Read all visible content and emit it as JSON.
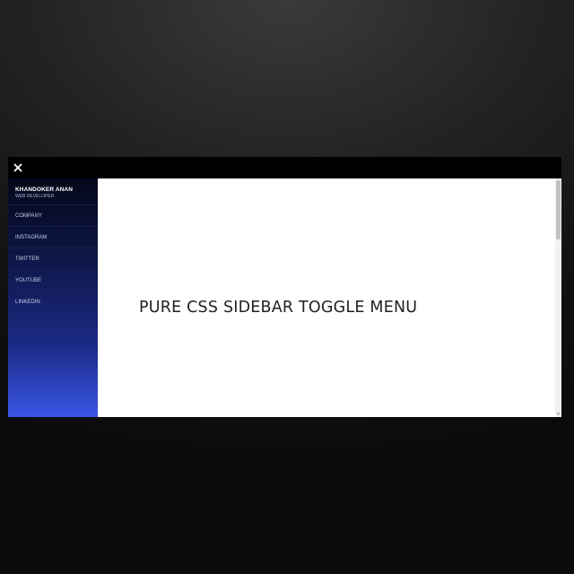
{
  "window": {
    "close_icon": "close-icon"
  },
  "sidebar": {
    "profile": {
      "name": "KHANDOKER ANAN",
      "role": "WEB DEVELOPER"
    },
    "items": [
      {
        "label": "COMPANY"
      },
      {
        "label": "INSTAGRAM"
      },
      {
        "label": "TWITTER"
      },
      {
        "label": "YOUTUBE"
      },
      {
        "label": "LINKEDIN"
      }
    ]
  },
  "main": {
    "headline": "PURE CSS SIDEBAR TOGGLE MENU"
  },
  "colors": {
    "page_background": "#1a1a1a",
    "topbar": "#000000",
    "sidebar_gradient_top": "#04071a",
    "sidebar_gradient_bottom": "#3a55e6",
    "content_background": "#ffffff",
    "headline_text": "#222222"
  }
}
